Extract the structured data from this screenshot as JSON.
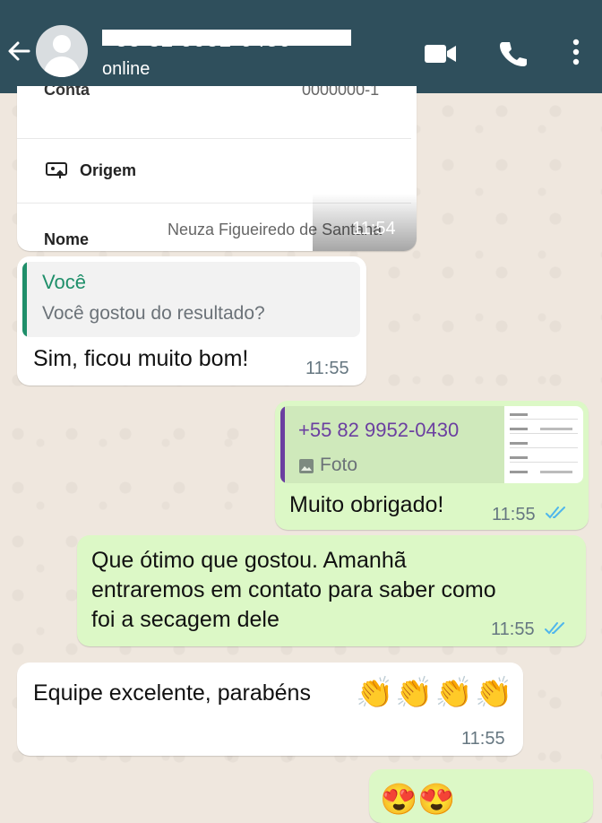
{
  "header": {
    "contact_name": "+55 82 9952-0430",
    "status": "online",
    "icons": [
      "back-arrow-icon",
      "avatar",
      "video-call-icon",
      "phone-icon",
      "more-options-icon"
    ]
  },
  "colors": {
    "header_bg": "#2f4f5c",
    "incoming_bubble": "#ffffff",
    "outgoing_bubble": "#dcf8c6",
    "quote_green": "#1f8f6a",
    "quote_purple": "#6b3fa0",
    "read_ticks": "#4fb6ec"
  },
  "messages": {
    "m1": {
      "row1_label": "Conta",
      "row1_value": "0000000-1",
      "row2_label": "Origem",
      "row3_label": "Nome",
      "row3_value": "Neuza Figueiredo de Santana",
      "time": "11:54"
    },
    "m2": {
      "quote_author": "Você",
      "quote_text": "Você gostou do resultado?",
      "text": "Sim, ficou muito bom!",
      "time": "11:55"
    },
    "m3": {
      "quote_author": "+55 82 9952-0430",
      "quote_media": "Foto",
      "text": "Muito obrigado!",
      "time": "11:55"
    },
    "m4": {
      "line1": "Que ótimo que gostou. Amanhã",
      "line2": "entraremos em contato para saber como",
      "line3": "foi a secagem dele",
      "time": "11:55"
    },
    "m5": {
      "text": "Equipe excelente, parabéns",
      "emoji": "👏👏👏👏",
      "time": "11:55"
    },
    "m6": {
      "emoji": "😍😍"
    }
  }
}
